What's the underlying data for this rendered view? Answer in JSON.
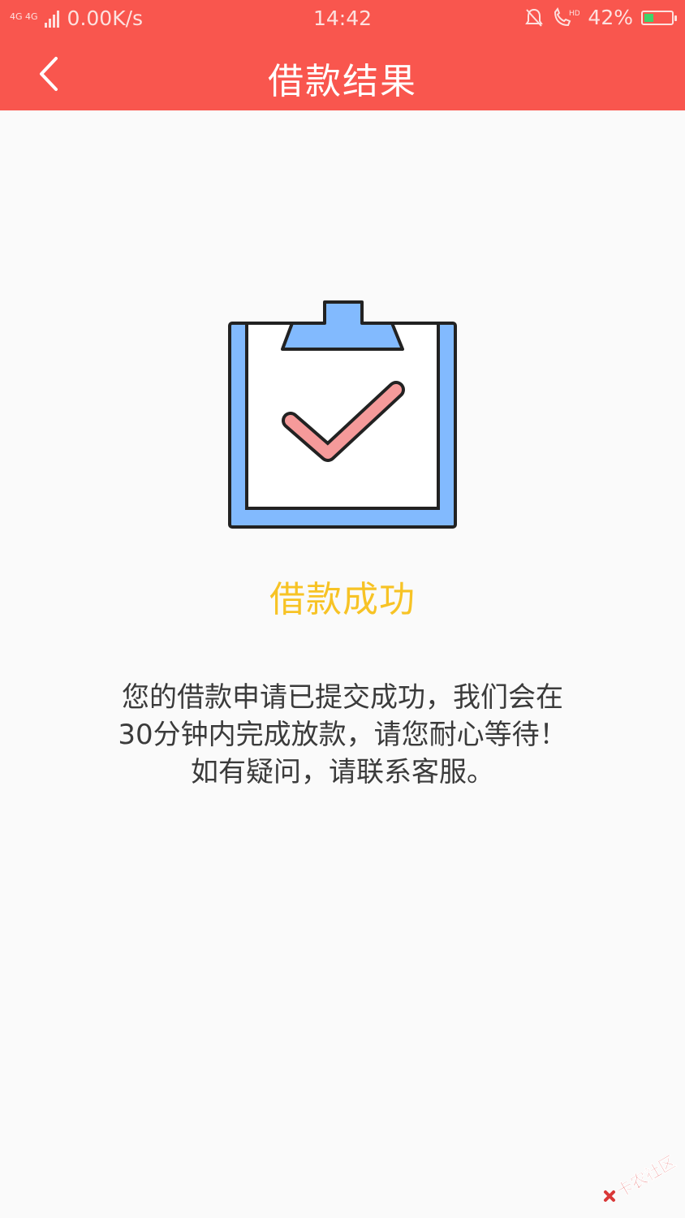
{
  "status_bar": {
    "network": "4G 4G",
    "speed": "0.00K/s",
    "time": "14:42",
    "battery": "42%",
    "battery_level": 0.42
  },
  "nav": {
    "title": "借款结果"
  },
  "result": {
    "title": "借款成功",
    "message_lines": [
      "您的借款申请已提交成功，我们会在",
      "30分钟内完成放款，请您耐心等待！",
      "如有疑问，请联系客服。"
    ]
  },
  "watermark": {
    "text": "卡农社区"
  },
  "colors": {
    "header": "#f9564e",
    "success_title": "#f7c325",
    "clipboard_blue": "#82bafe",
    "check_pink": "#f59a9a"
  }
}
